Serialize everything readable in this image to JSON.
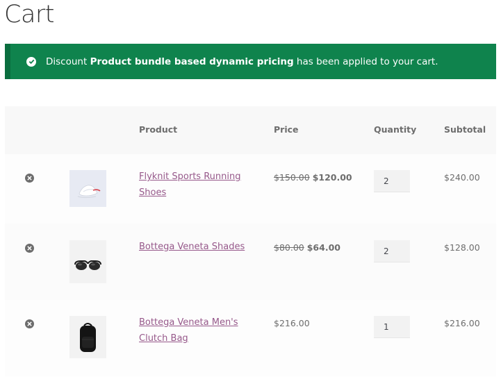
{
  "page": {
    "title": "Cart"
  },
  "notice": {
    "prefix": "Discount ",
    "discount_name": "Product bundle based dynamic pricing",
    "suffix": " has been applied to your cart.",
    "color": "#0f834d"
  },
  "table": {
    "headers": {
      "product": "Product",
      "price": "Price",
      "quantity": "Quantity",
      "subtotal": "Subtotal"
    },
    "rows": [
      {
        "name_line1": "Flyknit Sports Running",
        "name_line2": "Shoes",
        "regular_price": "$150.00",
        "sale_price": "$120.00",
        "quantity": "2",
        "subtotal": "$240.00",
        "image_icon": "running-shoes-image"
      },
      {
        "name_line1": "Bottega Veneta Shades",
        "name_line2": "",
        "regular_price": "$80.00",
        "sale_price": "$64.00",
        "quantity": "2",
        "subtotal": "$128.00",
        "image_icon": "sunglasses-image"
      },
      {
        "name_line1": "Bottega Veneta Men's",
        "name_line2": "Clutch Bag",
        "price": "$216.00",
        "quantity": "1",
        "subtotal": "$216.00",
        "image_icon": "backpack-image"
      }
    ]
  },
  "colors": {
    "link": "#96588a",
    "text": "#6d6d6d"
  }
}
